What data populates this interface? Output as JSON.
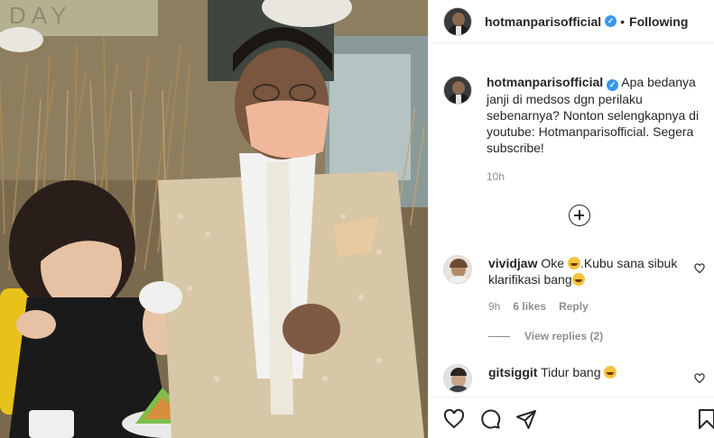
{
  "post": {
    "username": "hotmanparisofficial",
    "follow_status": "Following",
    "separator": "•",
    "caption": "Apa bedanya janji di medsos dgn perilaku sebenarnya? Nonton selengkapnya di youtube: Hotmanparisofficial. Segera subscribe!",
    "caption_time": "10h"
  },
  "media": {
    "sign_text": "DAY"
  },
  "comments": [
    {
      "username": "vividjaw",
      "text_a": "Oke ",
      "text_b": ".Kubu sana sibuk klarifikasi bang",
      "time": "9h",
      "likes": "6 likes",
      "reply_label": "Reply",
      "view_replies": "View replies (2)"
    },
    {
      "username": "gitsiggit",
      "text_a": "Tidur bang ",
      "text_b": ""
    }
  ],
  "icons": {
    "verified": "verified-badge",
    "load_more": "plus-circle-icon",
    "like": "heart-icon",
    "comment": "comment-icon",
    "share": "paper-plane-icon",
    "save": "bookmark-icon"
  },
  "colors": {
    "verified": "#3897f0",
    "secondary_text": "#8e8e8e",
    "primary_text": "#262626"
  }
}
